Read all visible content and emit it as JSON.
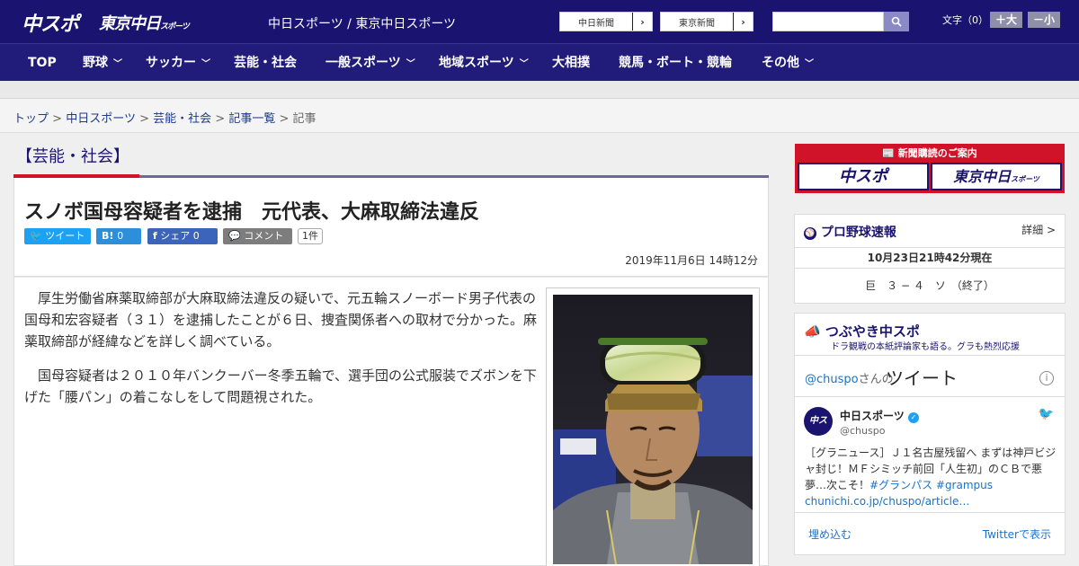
{
  "header": {
    "logo_primary": "中スポ",
    "logo_secondary": "東京中日",
    "logo_secondary_small": "スポーツ",
    "site_title": "中日スポーツ / 東京中日スポーツ",
    "link_chunichi": "中日新聞",
    "link_tokyo": "東京新聞",
    "font_size_label": "文字（0）",
    "font_larger": "＋大",
    "font_smaller": "－小",
    "colors": {
      "header_bg": "#1a1470",
      "nav_bg": "#211c7a",
      "accent_red": "#d1132a"
    }
  },
  "nav": {
    "items": [
      {
        "label": "TOP"
      },
      {
        "label": "野球"
      },
      {
        "label": "サッカー"
      },
      {
        "label": "芸能・社会"
      },
      {
        "label": "一般スポーツ"
      },
      {
        "label": "地域スポーツ"
      },
      {
        "label": "大相撲"
      },
      {
        "label": "競馬・ボート・競輪"
      },
      {
        "label": "その他"
      }
    ]
  },
  "breadcrumb": {
    "items": [
      "トップ",
      "中日スポーツ",
      "芸能・社会",
      "記事一覧"
    ],
    "current": "記事",
    "separator": ">"
  },
  "article": {
    "category": "【芸能・社会】",
    "headline": "スノボ国母容疑者を逮捕　元代表、大麻取締法違反",
    "share": {
      "twitter": "ツイート",
      "hatena_icon": "B!",
      "hatena_count": "0",
      "facebook": "シェア",
      "facebook_count": "0",
      "comment": "コメント",
      "comment_count": "1件"
    },
    "date": "2019年11月6日 14時12分",
    "paragraphs": [
      "厚生労働省麻薬取締部が大麻取締法違反の疑いで、元五輪スノーボード男子代表の国母和宏容疑者（３１）を逮捕したことが６日、捜査関係者への取材で分かった。麻薬取締部が経緯などを詳しく調べている。",
      "国母容疑者は２０１０年バンクーバー冬季五輪で、選手団の公式服装でズボンを下げた「腰パン」の着こなしをして問題視された。"
    ]
  },
  "sidebar": {
    "subscription": {
      "title": "新聞購読のご案内",
      "button_chuspo": "中スポ",
      "button_tokyo": "東京中日",
      "button_tokyo_small": "スポーツ"
    },
    "baseball": {
      "title": "プロ野球速報",
      "more": "詳細 >",
      "timestamp": "10月23日21時42分現在",
      "score": "巨　３ − ４　ソ　（終了）"
    },
    "tweets": {
      "title": "つぶやき中スポ",
      "subtitle": "ドラ観戦の本紙評論家も語る。グラも熱烈応援",
      "handle": "@chuspo",
      "handle_suffix": "さんの",
      "heading": "ツイート",
      "account_name": "中日スポーツ",
      "account_handle": "@chuspo",
      "tweet_text": "［グラニュース］Ｊ１名古屋残留へ まずは神戸ビジャ封じ！ＭＦシミッチ前回「人生初」のＣＢで悪夢…次こそ！",
      "tweet_tags": "#グランパス #grampus",
      "tweet_link": "chunichi.co.jp/chuspo/article…",
      "embed": "埋め込む",
      "view_on_twitter": "Twitterで表示"
    }
  }
}
